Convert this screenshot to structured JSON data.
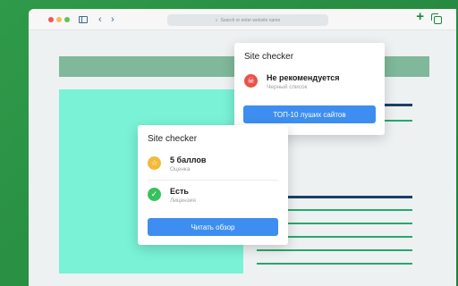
{
  "browser": {
    "address_placeholder": "Search or enter website name",
    "back_glyph": "‹",
    "forward_glyph": "›",
    "new_tab_glyph": "+"
  },
  "popup_top": {
    "title": "Site checker",
    "status_label": "Не рекомендуется",
    "status_sub": "Черный список",
    "button_label": "ТОП-10 луших сайтов",
    "icon_color": "#e8534a"
  },
  "popup_bottom": {
    "title": "Site checker",
    "score_label": "5 баллов",
    "score_sub": "Оценка",
    "license_label": "Есть",
    "license_sub": "Лицензия",
    "button_label": "Читать обзор",
    "score_icon_color": "#f3b93a",
    "license_icon_color": "#38c15f"
  },
  "colors": {
    "accent_green": "#1a8a39",
    "button_blue": "#3d8ef0",
    "mint_block": "#79f2d6"
  }
}
